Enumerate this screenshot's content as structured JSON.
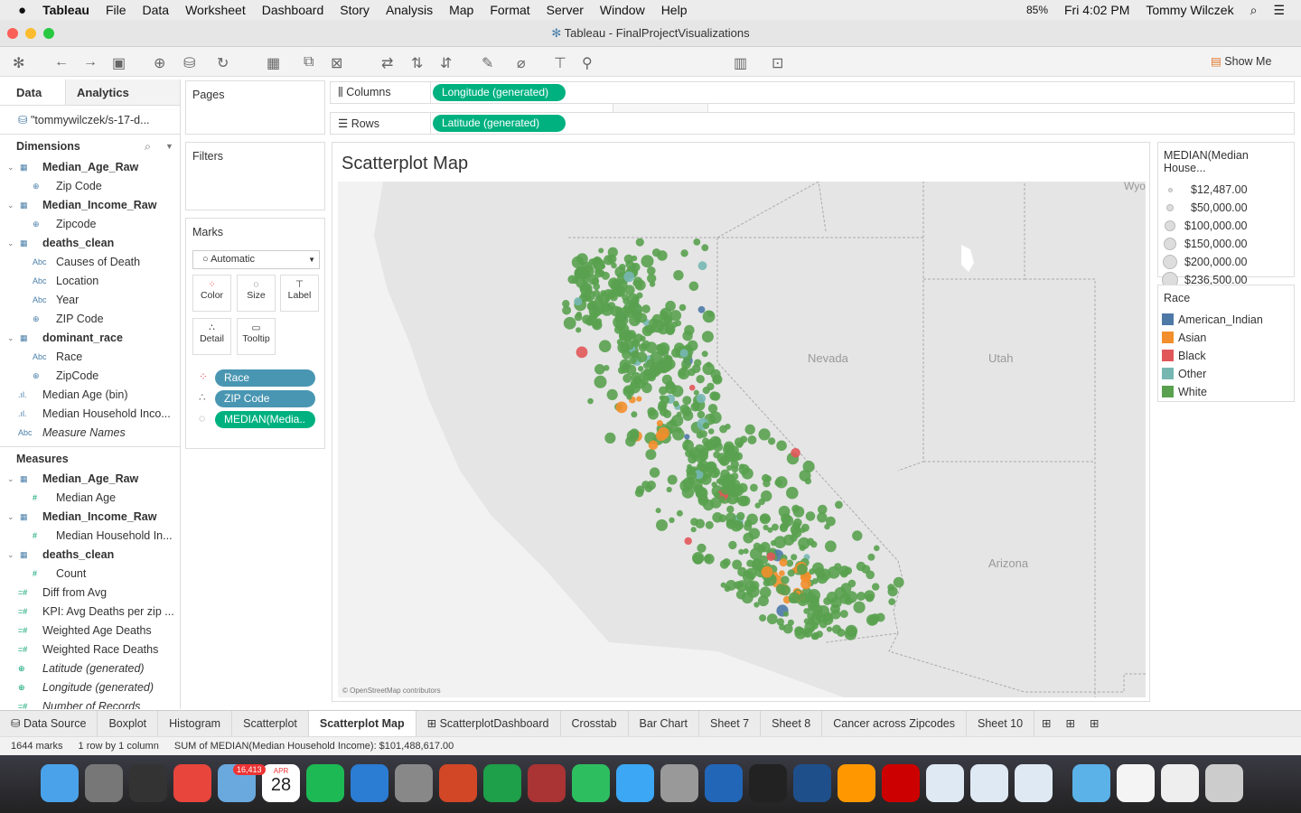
{
  "menubar": {
    "app": "Tableau",
    "items": [
      "File",
      "Data",
      "Worksheet",
      "Dashboard",
      "Story",
      "Analysis",
      "Map",
      "Format",
      "Server",
      "Window",
      "Help"
    ],
    "battery": "85%",
    "clock": "Fri 4:02 PM",
    "user": "Tommy Wilczek"
  },
  "window": {
    "title": "Tableau - FinalProjectVisualizations"
  },
  "toolbar": {
    "show_me": "Show Me"
  },
  "data_pane": {
    "tab_data": "Data",
    "tab_analytics": "Analytics",
    "datasource": "\"tommywilczek/s-17-d...",
    "dimensions_label": "Dimensions",
    "measures_label": "Measures",
    "dimensions": [
      {
        "label": "Median_Age_Raw",
        "type": "table",
        "level": 0
      },
      {
        "label": "Zip Code",
        "type": "geo",
        "level": 1
      },
      {
        "label": "Median_Income_Raw",
        "type": "table",
        "level": 0
      },
      {
        "label": "Zipcode",
        "type": "geo",
        "level": 1
      },
      {
        "label": "deaths_clean",
        "type": "table",
        "level": 0
      },
      {
        "label": "Causes of Death",
        "type": "abc",
        "level": 1
      },
      {
        "label": "Location",
        "type": "abc",
        "level": 1
      },
      {
        "label": "Year",
        "type": "abc",
        "level": 1
      },
      {
        "label": "ZIP Code",
        "type": "geo",
        "level": 1
      },
      {
        "label": "dominant_race",
        "type": "table",
        "level": 0
      },
      {
        "label": "Race",
        "type": "abc",
        "level": 1
      },
      {
        "label": "ZipCode",
        "type": "geo",
        "level": 1
      },
      {
        "label": "Median Age (bin)",
        "type": "bin",
        "level": 2
      },
      {
        "label": "Median Household Inco...",
        "type": "bin",
        "level": 2
      },
      {
        "label": "Measure Names",
        "type": "abc",
        "level": 2,
        "italic": true
      }
    ],
    "measures": [
      {
        "label": "Median_Age_Raw",
        "type": "table",
        "level": 0
      },
      {
        "label": "Median Age",
        "type": "num",
        "level": 1
      },
      {
        "label": "Median_Income_Raw",
        "type": "table",
        "level": 0
      },
      {
        "label": "Median Household In...",
        "type": "num",
        "level": 1
      },
      {
        "label": "deaths_clean",
        "type": "table",
        "level": 0
      },
      {
        "label": "Count",
        "type": "num",
        "level": 1
      },
      {
        "label": "Diff from Avg",
        "type": "calc",
        "level": 2
      },
      {
        "label": "KPI: Avg Deaths per zip ...",
        "type": "calc",
        "level": 2
      },
      {
        "label": "Weighted Age Deaths",
        "type": "calc",
        "level": 2
      },
      {
        "label": "Weighted Race Deaths",
        "type": "calc",
        "level": 2
      },
      {
        "label": "Latitude (generated)",
        "type": "geo",
        "level": 2,
        "italic": true
      },
      {
        "label": "Longitude (generated)",
        "type": "geo",
        "level": 2,
        "italic": true
      },
      {
        "label": "Number of Records",
        "type": "calc",
        "level": 2,
        "italic": true
      }
    ]
  },
  "cards": {
    "pages": "Pages",
    "filters": "Filters",
    "marks": "Marks",
    "mark_type": "Automatic",
    "buttons": [
      "Color",
      "Size",
      "Label",
      "Detail",
      "Tooltip"
    ],
    "pills": [
      {
        "label": "Race",
        "color": "#4996b2"
      },
      {
        "label": "ZIP Code",
        "color": "#4996b2"
      },
      {
        "label": "MEDIAN(Media..",
        "color": "#00b180"
      }
    ]
  },
  "shelves": {
    "columns_label": "Columns",
    "columns_pill": "Longitude (generated)",
    "rows_label": "Rows",
    "rows_pill": "Latitude (generated)"
  },
  "viz": {
    "title": "Scatterplot Map",
    "attribution": "© OpenStreetMap contributors",
    "state_labels": [
      "Nevada",
      "Utah",
      "Arizona",
      "Wyo"
    ]
  },
  "size_legend": {
    "title": "MEDIAN(Median House...",
    "items": [
      "$12,487.00",
      "$50,000.00",
      "$100,000.00",
      "$150,000.00",
      "$200,000.00",
      "$236,500.00"
    ]
  },
  "color_legend": {
    "title": "Race",
    "items": [
      {
        "label": "American_Indian",
        "color": "#4e79a7"
      },
      {
        "label": "Asian",
        "color": "#f28e2b"
      },
      {
        "label": "Black",
        "color": "#e15759"
      },
      {
        "label": "Other",
        "color": "#76b7b2"
      },
      {
        "label": "White",
        "color": "#59a14f"
      }
    ]
  },
  "sheet_tabs": [
    "Data Source",
    "Boxplot",
    "Histogram",
    "Scatterplot",
    "Scatterplot Map",
    "ScatterplotDashboard",
    "Crosstab",
    "Bar Chart",
    "Sheet 7",
    "Sheet 8",
    "Cancer across Zipcodes",
    "Sheet 10"
  ],
  "active_tab": "Scatterplot Map",
  "status": {
    "marks": "1644 marks",
    "dims": "1 row by 1 column",
    "sum": "SUM of MEDIAN(Median Household Income): $101,488,617.00"
  },
  "dock": {
    "mail_badge": "16,413",
    "calendar_month": "APR",
    "calendar_day": "28"
  }
}
